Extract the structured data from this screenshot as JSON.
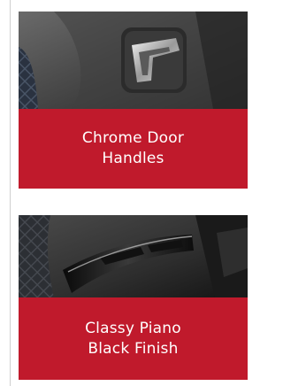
{
  "cards": [
    {
      "caption": "Chrome Door\nHandles",
      "image": "chrome-door-handle-photo"
    },
    {
      "caption": "Classy Piano\nBlack Finish",
      "image": "piano-black-window-switch-panel-photo"
    }
  ],
  "colors": {
    "caption_bg": "#c01a2c",
    "caption_text": "#ffffff"
  }
}
